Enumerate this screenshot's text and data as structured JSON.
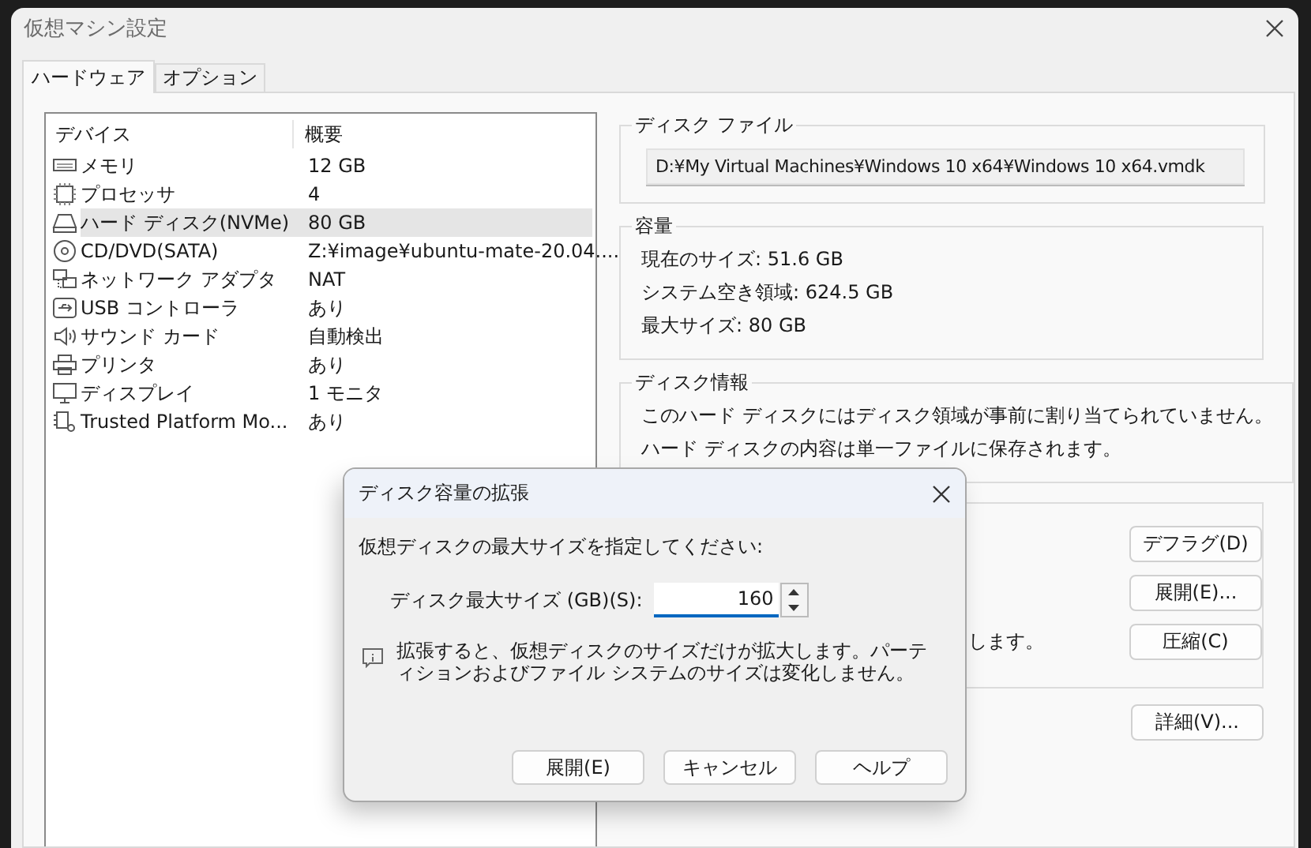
{
  "window": {
    "title": "仮想マシン設定"
  },
  "tabs": [
    {
      "label": "ハードウェア",
      "selected": true
    },
    {
      "label": "オプション",
      "selected": false
    }
  ],
  "device_list": {
    "columns": [
      "デバイス",
      "概要"
    ],
    "rows": [
      {
        "kind": "memory",
        "device": "メモリ",
        "summary": "12 GB",
        "selected": false
      },
      {
        "kind": "processor",
        "device": "プロセッサ",
        "summary": "4",
        "selected": false
      },
      {
        "kind": "harddisk",
        "device": "ハード ディスク(NVMe)",
        "summary": "80 GB",
        "selected": true
      },
      {
        "kind": "cd",
        "device": "CD/DVD(SATA)",
        "summary": "Z:¥image¥ubuntu-mate-20.04....",
        "selected": false
      },
      {
        "kind": "network",
        "device": "ネットワーク アダプタ",
        "summary": "NAT",
        "selected": false
      },
      {
        "kind": "usb",
        "device": "USB コントローラ",
        "summary": "あり",
        "selected": false
      },
      {
        "kind": "sound",
        "device": "サウンド カード",
        "summary": "自動検出",
        "selected": false
      },
      {
        "kind": "printer",
        "device": "プリンタ",
        "summary": "あり",
        "selected": false
      },
      {
        "kind": "display",
        "device": "ディスプレイ",
        "summary": "1 モニタ",
        "selected": false
      },
      {
        "kind": "tpm",
        "device": "Trusted Platform Mo...",
        "summary": "あり",
        "selected": false
      }
    ]
  },
  "disk_file": {
    "title": "ディスク ファイル",
    "path": "D:¥My Virtual Machines¥Windows 10 x64¥Windows 10 x64.vmdk"
  },
  "capacity": {
    "title": "容量",
    "lines": [
      "現在のサイズ: 51.6 GB",
      "システム空き領域: 624.5 GB",
      "最大サイズ: 80 GB"
    ]
  },
  "disk_info": {
    "title": "ディスク情報",
    "lines": [
      "このハード ディスクにはディスク領域が事前に割り当てられていません。",
      "ハード ディスクの内容は単一ファイルに保存されます。"
    ]
  },
  "utilities": {
    "text_fragment": "します。",
    "buttons": [
      "デフラグ(D)",
      "展開(E)...",
      "圧縮(C)"
    ]
  },
  "advanced_button": "詳細(V)...",
  "dialog": {
    "title": "ディスク容量の拡張",
    "prompt": "仮想ディスクの最大サイズを指定してください:",
    "size_label": "ディスク最大サイズ (GB)(S):",
    "size_value": "160",
    "note": "拡張すると、仮想ディスクのサイズだけが拡大します。パーティションおよびファイル システムのサイズは変化しません。",
    "buttons": [
      "展開(E)",
      "キャンセル",
      "ヘルプ"
    ]
  }
}
